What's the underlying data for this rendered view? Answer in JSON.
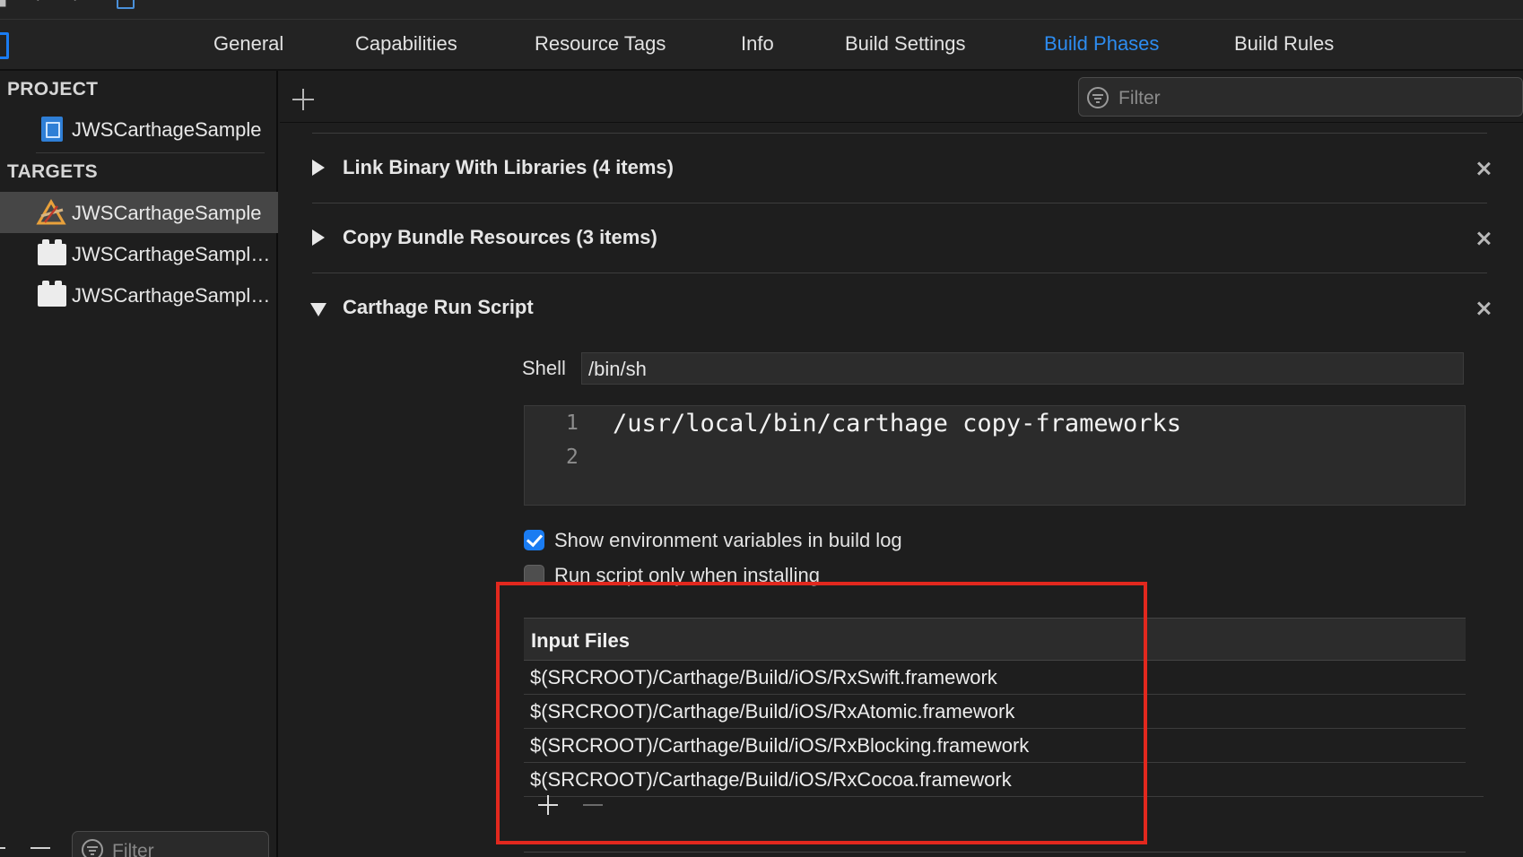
{
  "tabs": [
    {
      "label": "General",
      "active": false
    },
    {
      "label": "Capabilities",
      "active": false
    },
    {
      "label": "Resource Tags",
      "active": false
    },
    {
      "label": "Info",
      "active": false
    },
    {
      "label": "Build Settings",
      "active": false
    },
    {
      "label": "Build Phases",
      "active": true
    },
    {
      "label": "Build Rules",
      "active": false
    }
  ],
  "sidebar": {
    "project_header": "PROJECT",
    "project_item": "JWSCarthageSample",
    "targets_header": "TARGETS",
    "targets": [
      {
        "label": "JWSCarthageSample",
        "icon": "app-target-icon",
        "selected": true
      },
      {
        "label": "JWSCarthageSampleTests",
        "icon": "bundle-icon",
        "selected": false
      },
      {
        "label": "JWSCarthageSampleUITests",
        "icon": "bundle-icon",
        "selected": false
      }
    ],
    "filter_placeholder": "Filter"
  },
  "toolbar": {
    "filter_placeholder": "Filter"
  },
  "phases": {
    "link_binary": "Link Binary With Libraries (4 items)",
    "copy_bundle": "Copy Bundle Resources (3 items)",
    "run_script": "Carthage Run Script"
  },
  "run_script": {
    "shell_label": "Shell",
    "shell_value": "/bin/sh",
    "script_lines": [
      {
        "number": "1",
        "code": "/usr/local/bin/carthage copy-frameworks"
      },
      {
        "number": "2",
        "code": ""
      }
    ],
    "show_env_label": "Show environment variables in build log",
    "show_env_checked": true,
    "run_only_label": "Run script only when installing",
    "run_only_checked": false,
    "input_files_header": "Input Files",
    "input_files": [
      "$(SRCROOT)/Carthage/Build/iOS/RxSwift.framework",
      "$(SRCROOT)/Carthage/Build/iOS/RxAtomic.framework",
      "$(SRCROOT)/Carthage/Build/iOS/RxBlocking.framework",
      "$(SRCROOT)/Carthage/Build/iOS/RxCocoa.framework"
    ]
  },
  "colors": {
    "accent": "#1a7cf2",
    "active_tab": "#2d8cf0",
    "highlight_box": "#e2281e",
    "background": "#1e1e1e"
  }
}
